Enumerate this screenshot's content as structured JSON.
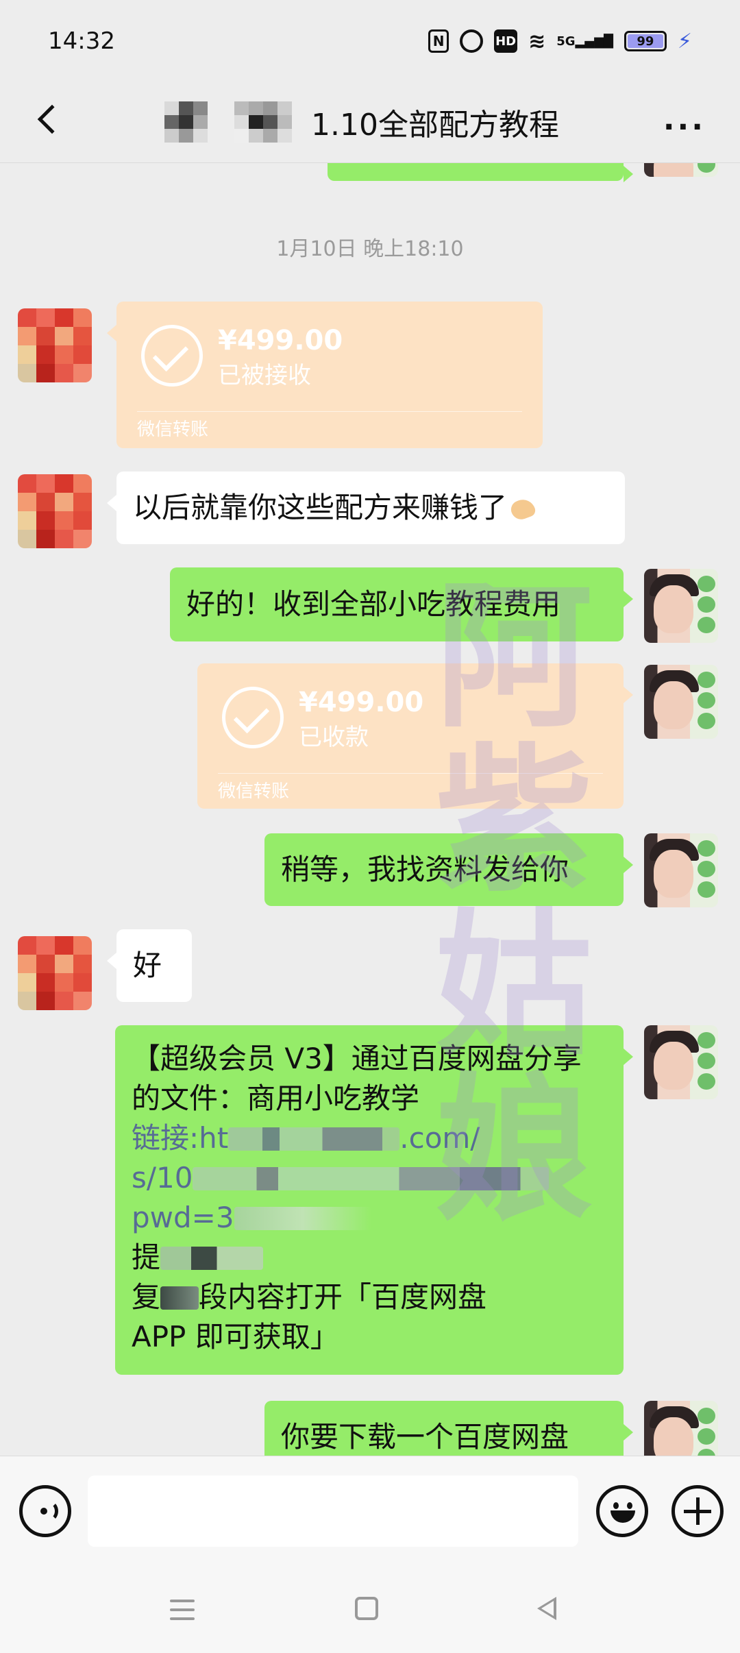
{
  "status_bar": {
    "time": "14:32",
    "icons": [
      "nfc-icon",
      "alarm-icon",
      "hd-icon",
      "wifi-icon",
      "5g-signal-icon",
      "battery-icon",
      "charging-icon"
    ],
    "nfc": "N",
    "hd": "HD",
    "wifi": "≋",
    "signal": "5G▂▄▆█",
    "battery_level": "99",
    "charging": "⚡"
  },
  "header": {
    "title": "1.10全部配方教程",
    "more": "···"
  },
  "messages": {
    "timestamp": "1月10日 晚上18:10",
    "transfer_received": {
      "amount": "¥499.00",
      "status": "已被接收",
      "source": "微信转账"
    },
    "msg_recipes": "以后就靠你这些配方来赚钱了",
    "msg_ok_fee": "好的！收到全部小吃教程费用",
    "transfer_collected": {
      "amount": "¥499.00",
      "status": "已收款",
      "source": "微信转账"
    },
    "msg_wait": "稍等，我找资料发给你",
    "msg_good": "好",
    "share": {
      "line1": "【超级会员 V3】通过百度网盘分享",
      "line2": "的文件：商用小吃教学",
      "line3_prefix": "链接:ht",
      "line3_suffix": ".com/",
      "line4_prefix": "s/10",
      "line5_prefix": "pwd=3",
      "line6_prefix": "提",
      "line7_prefix": "复",
      "line7_suffix": "段内容打开「百度网盘",
      "line8": "APP 即可获取」"
    },
    "msg_download": "你要下载一个百度网盘"
  },
  "watermark": [
    "阿",
    "紫",
    "姑",
    "娘"
  ],
  "colors": {
    "bubble_green": "#95ec69",
    "bubble_white": "#ffffff",
    "transfer_orange": "#fde2c4",
    "link": "#576b95",
    "background": "#ededed"
  },
  "input_bar": {
    "voice_icon": "voice-icon",
    "emoji_icon": "emoji-icon",
    "plus_icon": "plus-icon",
    "value": ""
  }
}
